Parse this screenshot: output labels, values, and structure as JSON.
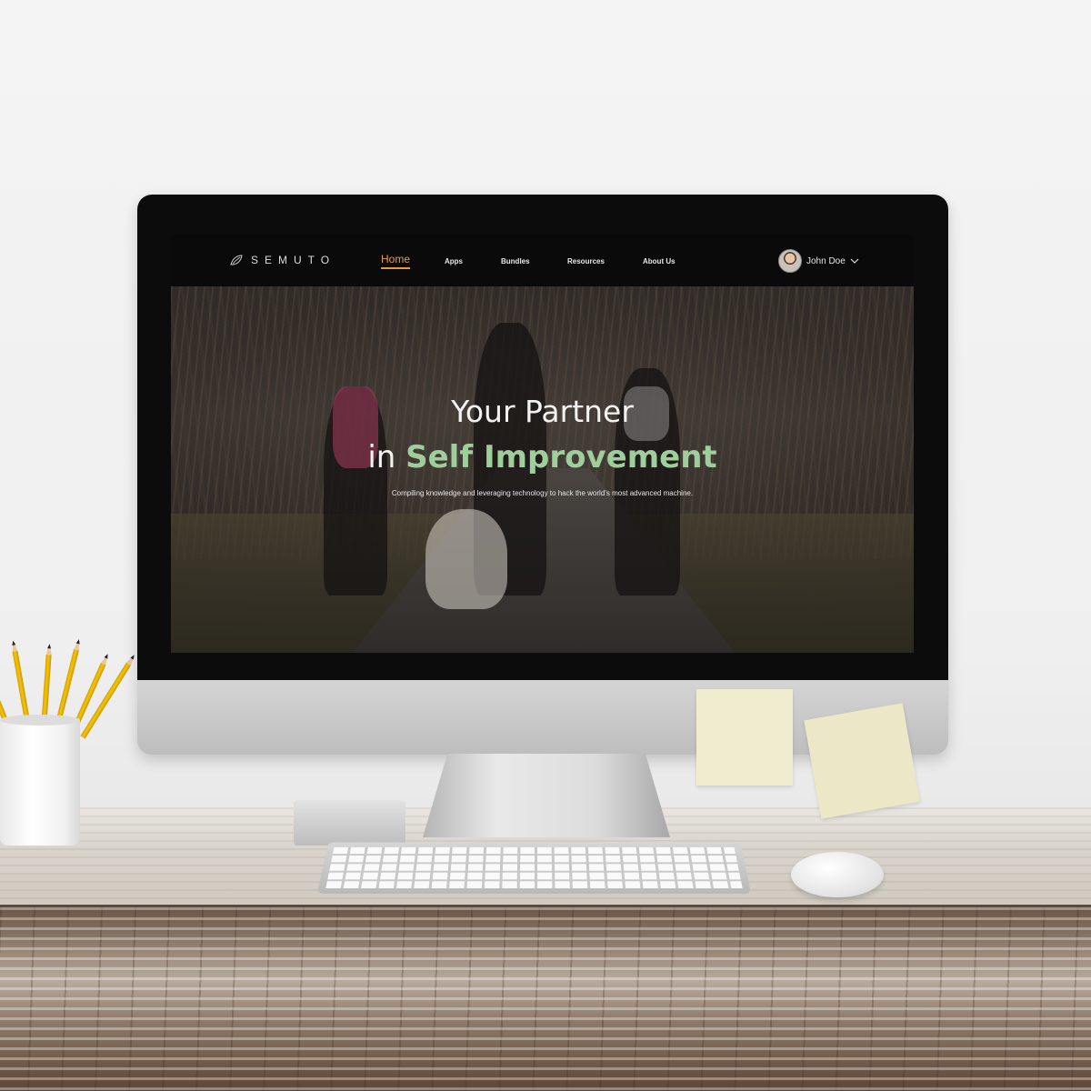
{
  "brand": {
    "logo_text": "SEMUTO",
    "logo_icon": "leaf-logo-icon"
  },
  "nav": {
    "items": [
      {
        "label": "Home",
        "active": true
      },
      {
        "label": "Apps",
        "active": false
      },
      {
        "label": "Bundles",
        "active": false
      },
      {
        "label": "Resources",
        "active": false
      },
      {
        "label": "About Us",
        "active": false
      }
    ]
  },
  "user": {
    "name": "John Doe",
    "menu_icon": "chevron-down-icon"
  },
  "hero": {
    "line1": "Your Partner",
    "line2_prefix": "in ",
    "line2_highlight": "Self Improvement",
    "subtitle": "Compiling knowledge and leveraging technology to hack the world’s most advanced machine."
  },
  "colors": {
    "accent": "#e79c3b",
    "highlight": "#9fce9c",
    "navbar_bg": "#0a0a0a"
  }
}
